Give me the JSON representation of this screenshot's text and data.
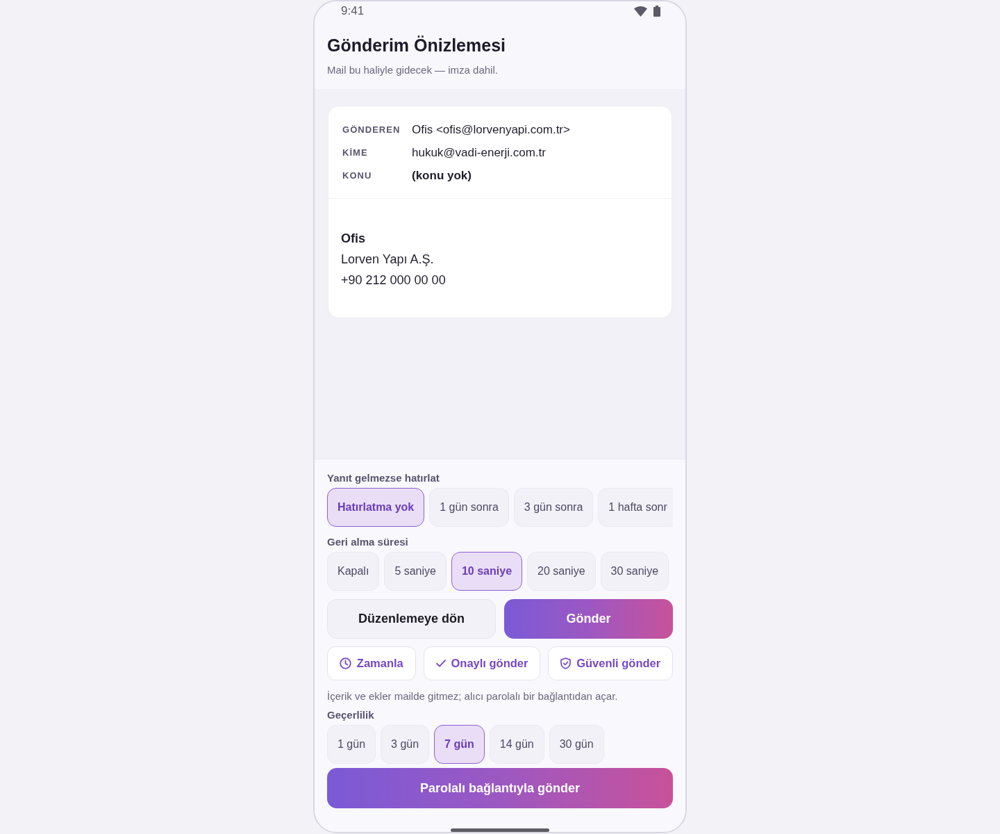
{
  "status_bar": {
    "time": "9:41"
  },
  "header": {
    "title": "Gönderim Önizlemesi",
    "subtitle": "Mail bu haliyle gidecek — imza dahil."
  },
  "message": {
    "fields": [
      {
        "label": "GÖNDEREN",
        "value": "Ofis <ofis@lorvenyapi.com.tr>",
        "kind": "address"
      },
      {
        "label": "KİME",
        "value": "hukuk@vadi-enerji.com.tr",
        "kind": "address"
      },
      {
        "label": "KONU",
        "value": "(konu yok)",
        "kind": "empty"
      }
    ],
    "signature": [
      {
        "text": "Ofis",
        "kind": "name"
      },
      {
        "text": "Lorven Yapı A.Ş.",
        "kind": "line"
      },
      {
        "text": "+90 212 000 00 00",
        "kind": "line"
      }
    ]
  },
  "reminder": {
    "label": "Yanıt gelmezse hatırlat",
    "options": [
      {
        "label": "Hatırlatma yok",
        "selected": true
      },
      {
        "label": "1 gün sonra",
        "selected": false
      },
      {
        "label": "3 gün sonra",
        "selected": false
      },
      {
        "label": "1 hafta sonr",
        "selected": false
      }
    ]
  },
  "undo": {
    "label": "Geri alma süresi",
    "options": [
      {
        "label": "Kapalı",
        "selected": false
      },
      {
        "label": "5 saniye",
        "selected": false
      },
      {
        "label": "10 saniye",
        "selected": true
      },
      {
        "label": "20 saniye",
        "selected": false
      },
      {
        "label": "30 saniye",
        "selected": false
      }
    ]
  },
  "actions": [
    {
      "label": "Düzenlemeye dön",
      "kind": "secondary"
    },
    {
      "label": "Gönder",
      "kind": "primary"
    }
  ],
  "send_modes": [
    {
      "label": "Zamanla",
      "kind": "schedule"
    },
    {
      "label": "Onaylı gönder",
      "kind": "confirmed"
    },
    {
      "label": "Güvenli gönder",
      "kind": "secure"
    }
  ],
  "secure_link": {
    "note": "İçerik ve ekler mailde gitmez; alıcı parolalı bir bağlantıdan açar.",
    "validity": {
      "label": "Geçerlilik",
      "options": [
        {
          "label": "1 gün",
          "selected": false
        },
        {
          "label": "3 gün",
          "selected": false
        },
        {
          "label": "7 gün",
          "selected": true
        },
        {
          "label": "14 gün",
          "selected": false
        },
        {
          "label": "30 gün",
          "selected": false
        }
      ]
    },
    "submit": "Parolalı bağlantıyla gönder"
  }
}
